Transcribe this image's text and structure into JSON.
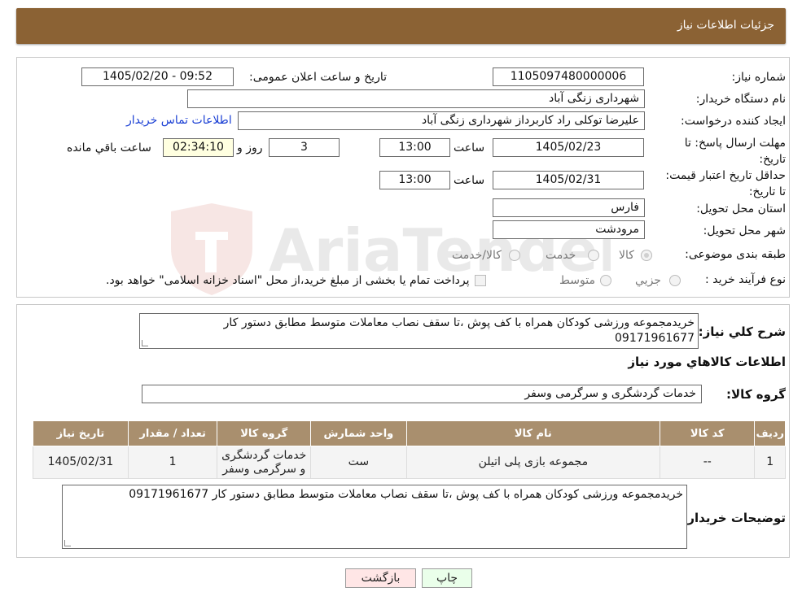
{
  "header": {
    "title": "جزئیات اطلاعات نیاز"
  },
  "labels": {
    "need_number": "شماره نیاز:",
    "announce_datetime": "تاریخ و ساعت اعلان عمومی:",
    "buyer_org": "نام دستگاه خریدار:",
    "requester": "ایجاد کننده درخواست:",
    "reply_deadline": "مهلت ارسال پاسخ: تا تاریخ:",
    "time": "ساعت",
    "day_and": "روز و",
    "remaining": "ساعت باقي مانده",
    "price_validity": "حداقل تاریخ اعتبار قیمت: تا تاریخ:",
    "province": "استان محل تحویل:",
    "city": "شهر محل تحویل:",
    "category": "طبقه بندی موضوعی:",
    "purchase_type": "نوع فرآیند خرید :",
    "general_desc": "شرح کلي نياز:",
    "goods_info": "اطلاعات کالاهاي مورد نياز",
    "goods_group": "گروه کالا:",
    "buyer_notes": "توضیحات خریدار:"
  },
  "values": {
    "need_number": "1105097480000006",
    "announce_datetime": "1405/02/20 - 09:52",
    "buyer_org": "شهرداری زنگی آباد",
    "requester": "علیرضا توکلی راد کاربرداز شهرداری زنگی آباد",
    "contact_link": "اطلاعات تماس خریدار",
    "reply_date": "1405/02/23",
    "reply_time": "13:00",
    "days": "3",
    "remaining_time": "02:34:10",
    "validity_date": "1405/02/31",
    "validity_time": "13:00",
    "province": "فارس",
    "city": "مرودشت",
    "general_desc": "خریدمجموعه ورزشی کودکان همراه با کف پوش ،تا سقف نصاب معاملات متوسط  مطابق دستور کار 09171961677",
    "goods_group": "خدمات گردشگری و سرگرمی وسفر",
    "buyer_notes": "خریدمجموعه ورزشی کودکان همراه با کف پوش ،تا سقف نصاب معاملات متوسط  مطابق دستور کار 09171961677"
  },
  "category_options": [
    "کالا",
    "خدمت",
    "کالا/خدمت"
  ],
  "purchase_options": [
    "جزيي",
    "متوسط"
  ],
  "purchase_note": "پرداخت تمام یا بخشی از مبلغ خرید،از محل \"اسناد خزانه اسلامی\" خواهد بود.",
  "table": {
    "headers": [
      "ردیف",
      "کد کالا",
      "نام کالا",
      "واحد شمارش",
      "گروه کالا",
      "تعداد / مقدار",
      "تاریخ نیاز"
    ],
    "rows": [
      [
        "1",
        "--",
        "مجموعه بازی پلی اتیلن",
        "ست",
        "خدمات گردشگری و سرگرمی وسفر",
        "1",
        "1405/02/31"
      ]
    ]
  },
  "buttons": {
    "print": "چاپ",
    "back": "بازگشت"
  },
  "watermark": "AriaTender.neT",
  "colors": {
    "header_bg": "#8b6234",
    "table_header_bg": "#a98f6e",
    "link": "#1a3fd4"
  }
}
